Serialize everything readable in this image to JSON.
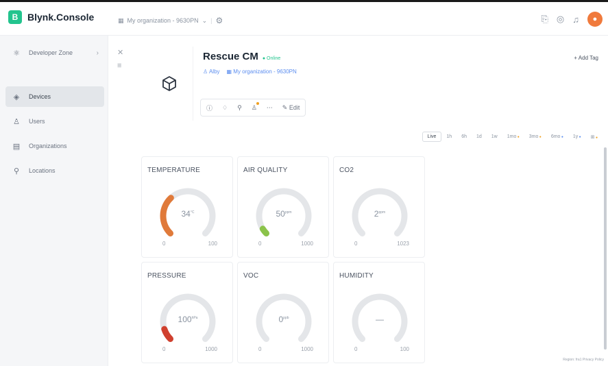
{
  "app": {
    "logo_letter": "B",
    "name": "Blynk.Console"
  },
  "header": {
    "org_selector": "My organization - 9630PN",
    "icons": [
      "notification-icon",
      "help-icon",
      "bell-icon"
    ],
    "avatar_color": "#f07a3c"
  },
  "sidebar": {
    "items": [
      {
        "label": "Developer Zone",
        "icon": "developer-zone-icon"
      },
      {
        "label": "Devices",
        "icon": "devices-icon",
        "active": true
      },
      {
        "label": "Users",
        "icon": "users-icon"
      },
      {
        "label": "Organizations",
        "icon": "organizations-icon"
      },
      {
        "label": "Locations",
        "icon": "locations-icon"
      }
    ]
  },
  "device": {
    "name": "Rescue CM",
    "status": "Online",
    "owner": "Alby",
    "organization": "My organization - 9630PN",
    "edit_label": "Edit",
    "add_tag_label": "Add Tag"
  },
  "time_range": {
    "options": [
      "Live",
      "1h",
      "6h",
      "1d",
      "1w",
      "1mo",
      "3mo",
      "6mo",
      "1y",
      "⊞"
    ],
    "selected": "Live"
  },
  "widgets": [
    {
      "title": "TEMPERATURE",
      "value": "34",
      "unit": "°C",
      "min": "0",
      "max": "100",
      "fraction": 0.34,
      "color": "#e07a3a"
    },
    {
      "title": "AIR QUALITY",
      "value": "50",
      "unit": "ppm",
      "min": "0",
      "max": "1000",
      "fraction": 0.05,
      "color": "#8bc34a"
    },
    {
      "title": "CO2",
      "value": "2",
      "unit": "ppm",
      "min": "0",
      "max": "1023",
      "fraction": 0.0,
      "color": "#cccccc"
    },
    {
      "title": "PRESSURE",
      "value": "100",
      "unit": "hPa",
      "min": "0",
      "max": "1000",
      "fraction": 0.1,
      "color": "#d0402e"
    },
    {
      "title": "VOC",
      "value": "0",
      "unit": "ppb",
      "min": "0",
      "max": "1000",
      "fraction": 0.0,
      "color": "#cccccc"
    },
    {
      "title": "HUMIDITY",
      "value": "—",
      "unit": "",
      "min": "0",
      "max": "100",
      "fraction": 0.0,
      "color": "#cccccc"
    }
  ],
  "footer": {
    "region": "Region: fra1",
    "privacy": "Privacy Policy"
  }
}
